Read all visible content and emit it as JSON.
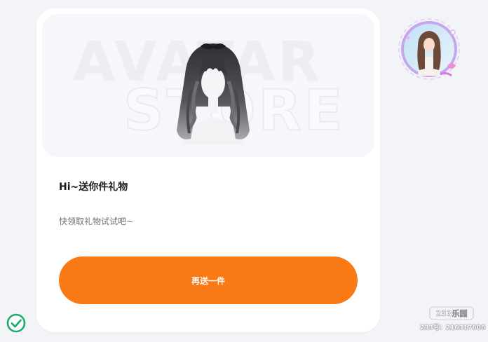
{
  "banner": {
    "watermark_top": "AVATAR",
    "watermark_bottom": "STORE"
  },
  "gift": {
    "title": "Hi~送你件礼物",
    "subtitle": "快领取礼物试试吧~",
    "button_label": "再送一件"
  },
  "corner": {
    "logo_text": "233乐园",
    "watermark": "233号：216317606"
  },
  "colors": {
    "accent": "#f97915",
    "check": "#1faa6a"
  },
  "icons": {
    "hair_item": "hair-item-icon",
    "avatar": "avatar-icon",
    "status": "check-circle-icon"
  }
}
